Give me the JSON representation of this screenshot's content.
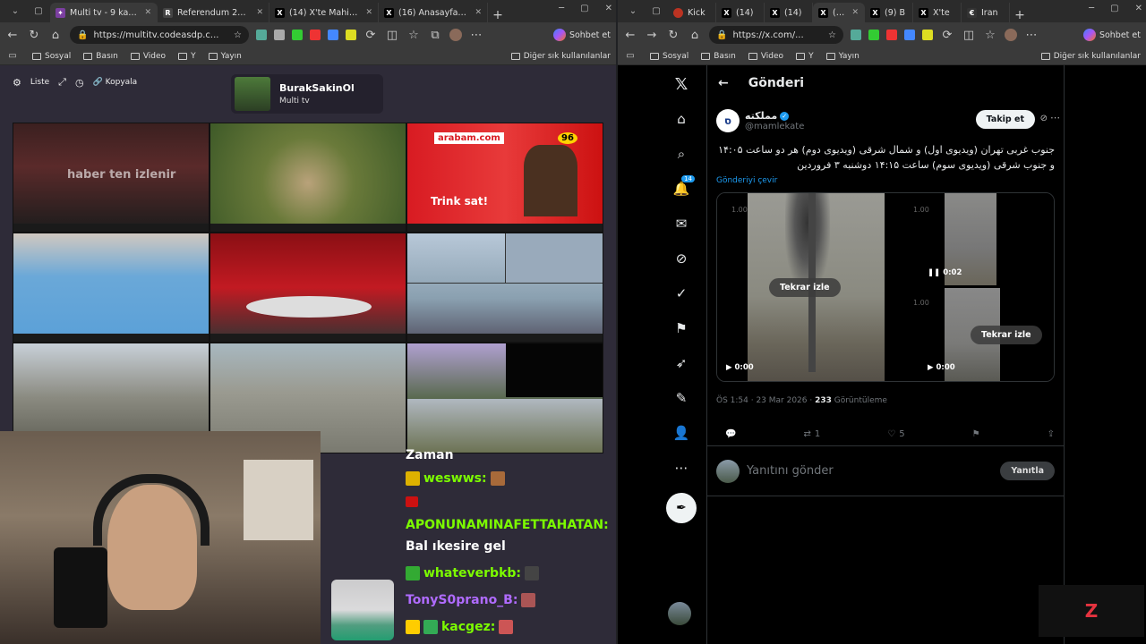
{
  "left_window": {
    "tabs": [
      {
        "title": "Multi tv - 9 kanal izlenir",
        "active": true,
        "fav_color": "#7b3fa0"
      },
      {
        "title": "Referendum 2026, ogg...",
        "active": false,
        "fav_color": "#2a2a2a",
        "fav_letter": "R"
      },
      {
        "title": "(14) X'te Mahir KILIÇ: \"...",
        "active": false,
        "fav_color": "#000",
        "fav_letter": "X"
      },
      {
        "title": "(16) Anasayfa / X",
        "active": false,
        "fav_color": "#000",
        "fav_letter": "X"
      }
    ],
    "url": "https://multitv.codeasdp.c...",
    "sohbet": "Sohbet et",
    "bookmarks": [
      "Sosyal",
      "Basın",
      "Video",
      "Y",
      "Yayın"
    ],
    "bookmarks_right": "Diğer sık kullanılanlar"
  },
  "right_window": {
    "tabs": [
      {
        "title": "Kick",
        "fav_color": "#b32"
      },
      {
        "title": "(14)",
        "fav_color": "#000",
        "fav_letter": "X"
      },
      {
        "title": "(14)",
        "fav_color": "#000",
        "fav_letter": "X"
      },
      {
        "title": "(14)",
        "fav_color": "#000",
        "fav_letter": "X",
        "active": true
      },
      {
        "title": "(9) B",
        "fav_color": "#000",
        "fav_letter": "X"
      },
      {
        "title": "X'te",
        "fav_color": "#000",
        "fav_letter": "X"
      },
      {
        "title": "Iran",
        "fav_color": "#333",
        "fav_letter": "€"
      }
    ],
    "url": "https://x.com/...",
    "sohbet": "Sohbet et",
    "bookmarks": [
      "Sosyal",
      "Basın",
      "Video",
      "Y",
      "Yayın"
    ],
    "bookmarks_right": "Diğer sık kullanılanlar"
  },
  "multitv": {
    "toolbar": {
      "list": "Liste",
      "copy": "Kopyala"
    },
    "user": {
      "name": "BurakSakinOl",
      "subtitle": "Multi tv"
    },
    "channels": {
      "c1_caption": "haber ten izlenir",
      "c3_logo": "arabam.com",
      "c3_caption": "Trink sat!",
      "c3_badge": "96"
    }
  },
  "chat": [
    {
      "text": "Zaman",
      "user": "",
      "color": "#ffffff"
    },
    {
      "user": "weswws:",
      "text": "",
      "color": "#7cfc00"
    },
    {
      "user": "",
      "text": "",
      "color": "#ffffff"
    },
    {
      "user": "APONUNAMINAFETTAHATAN:",
      "text": "Bal ıkesire gel",
      "color": "#7cfc00"
    },
    {
      "user": "whateverbkb:",
      "text": "",
      "color": "#7cfc00"
    },
    {
      "user": "TonyS0prano_B:",
      "text": "",
      "color": "#b06bff"
    },
    {
      "user": "kacgez:",
      "text": "",
      "color": "#7cfc00"
    }
  ],
  "x": {
    "header": "Gönderi",
    "author": {
      "name": "مملكته",
      "handle": "@mamlekate",
      "avatar_letter": "ס"
    },
    "follow": "Takip et",
    "tweet_text": "جنوب غربی تهران (ویدیوی اول) و شمال شرقی (ویدیوی دوم) هر دو ساعت ۱۴:۰۵ و جنوب شرقی (ویدیوی سوم) ساعت ۱۴:۱۵ دوشنبه ۳ فروردین",
    "translate": "Gönderiyi çevir",
    "video1": {
      "speed": "1.00",
      "replay": "Tekrar izle",
      "time": "0:00"
    },
    "video2": {
      "speed_top": "1.00",
      "time_top": "0:02",
      "speed_bottom": "1.00",
      "replay": "Tekrar izle",
      "time_bottom": "0:00"
    },
    "meta_time": "ÖS 1:54 · 23 Mar 2026 · ",
    "views": "233",
    "views_label": " Görüntüleme",
    "retweets": "1",
    "likes": "5",
    "reply_placeholder": "Yanıtını gönder",
    "reply_button": "Yanıtla",
    "nav_badge": "14"
  }
}
